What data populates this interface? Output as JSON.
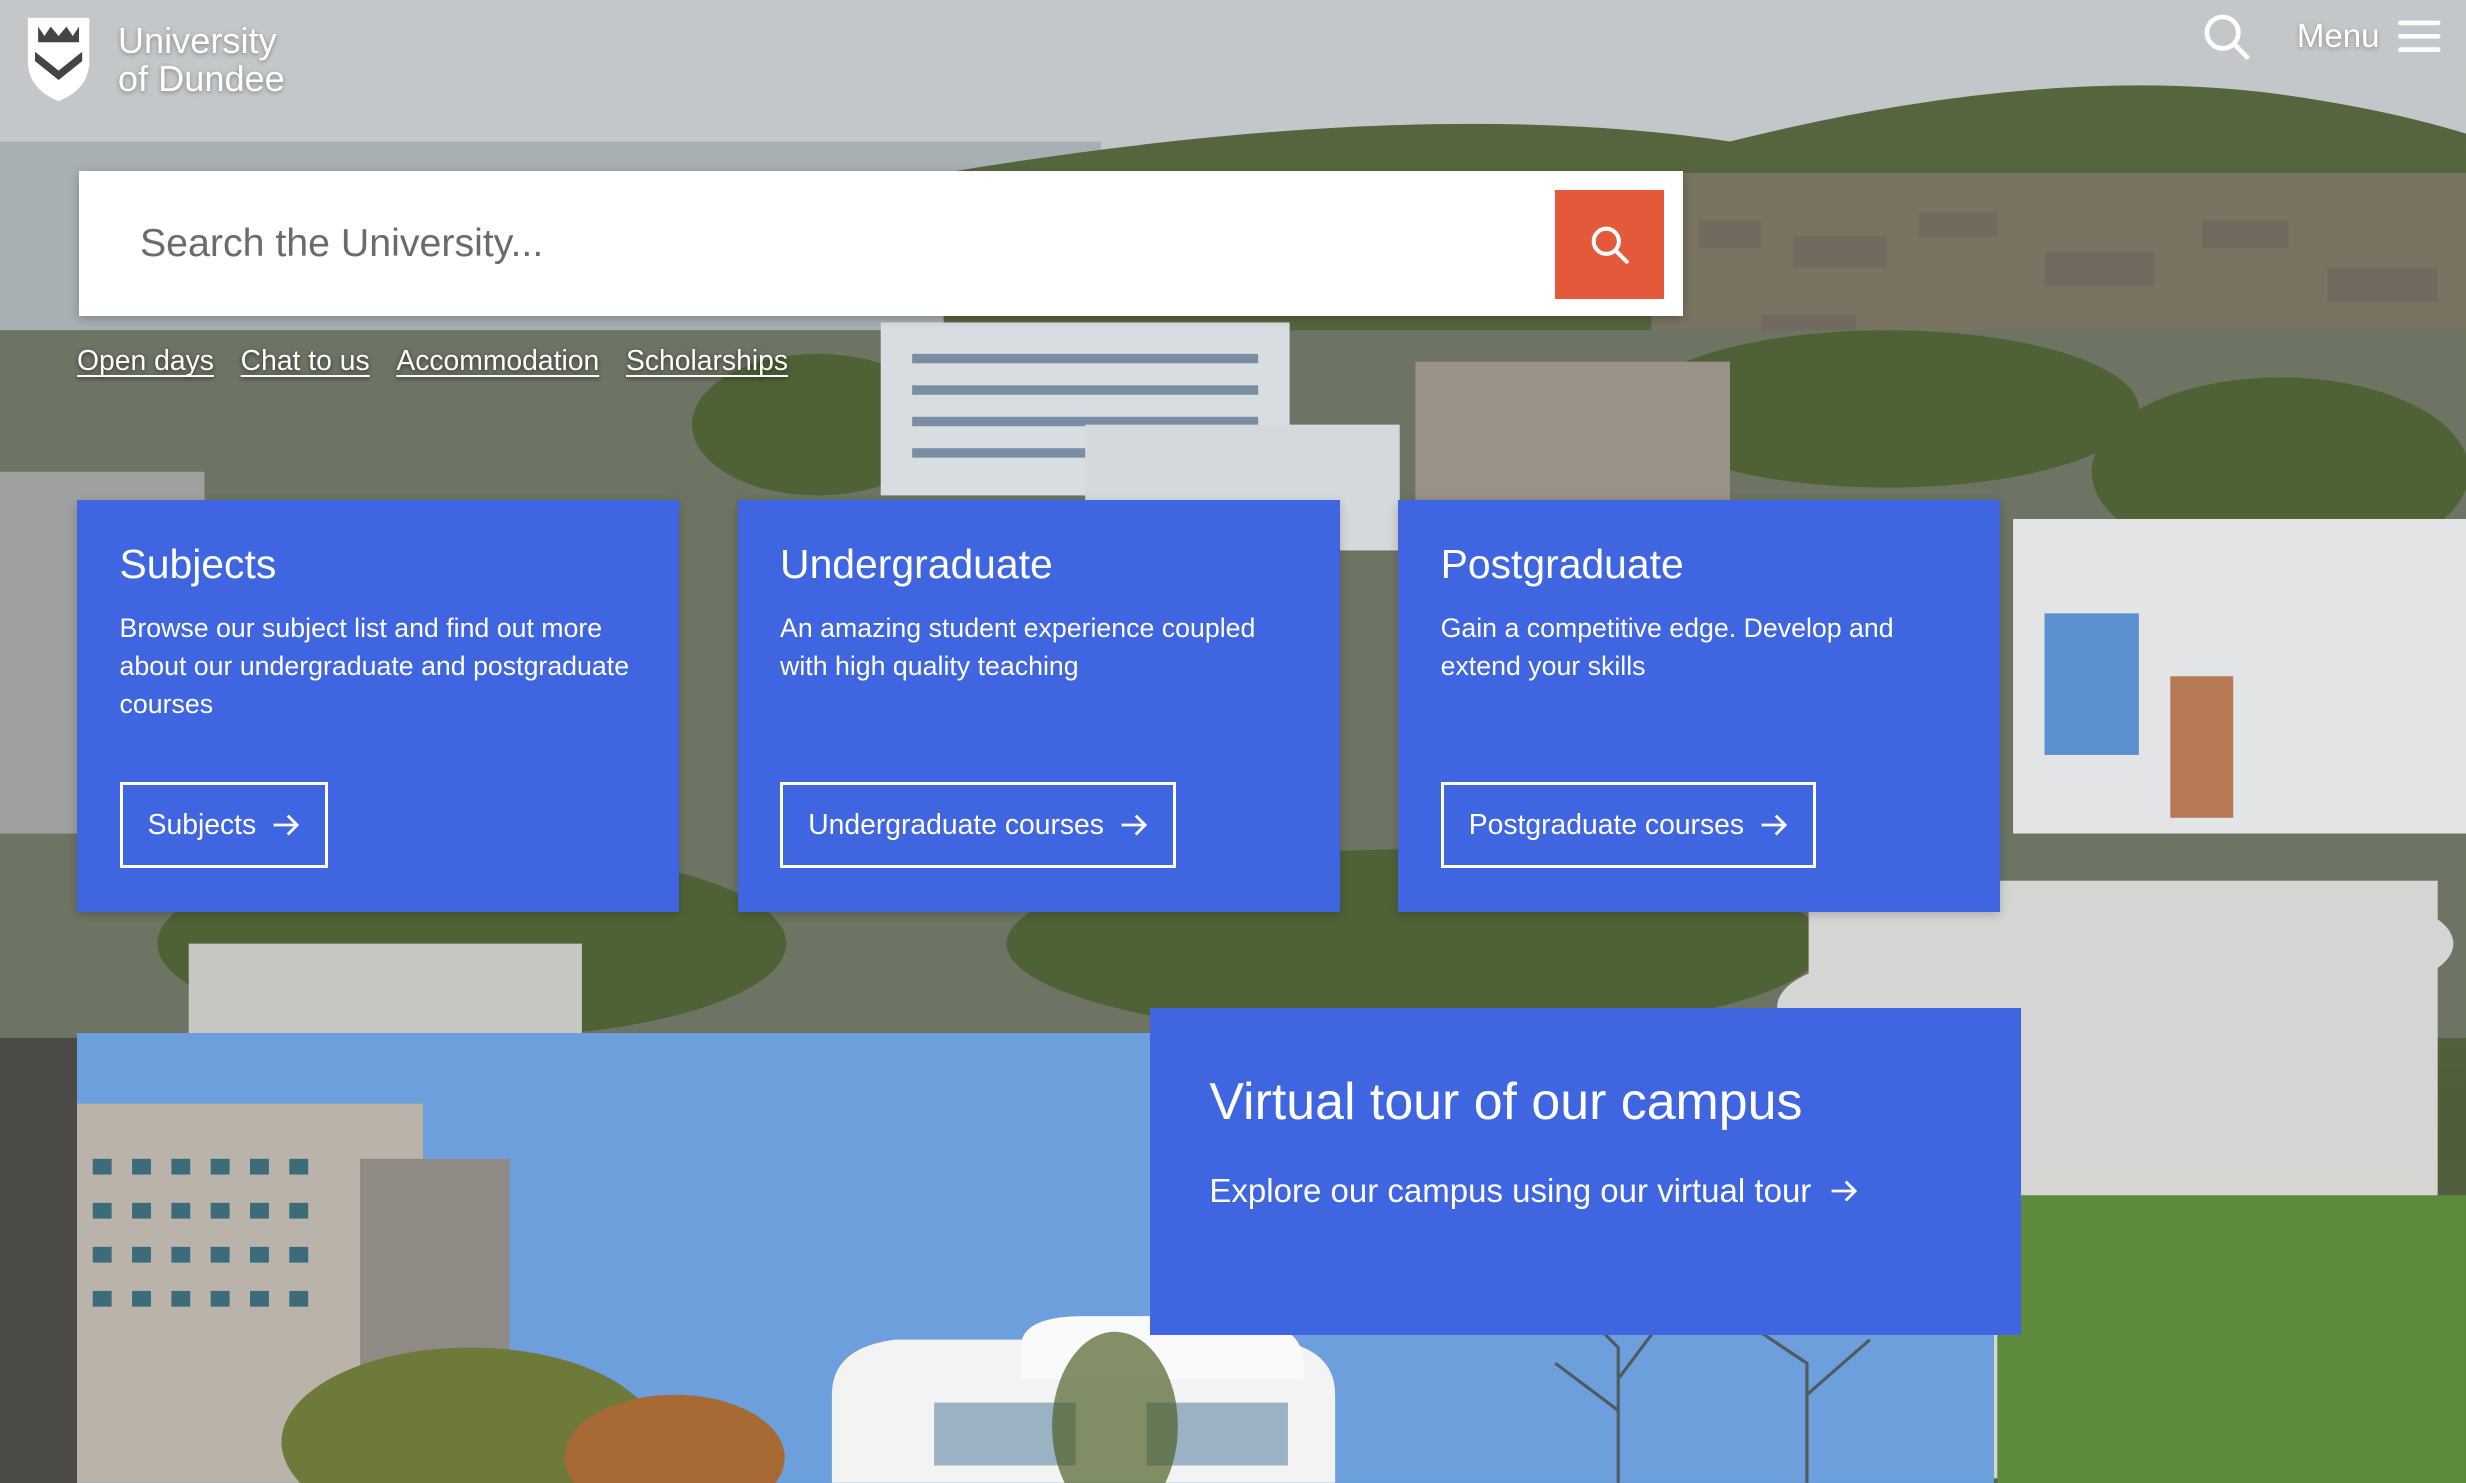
{
  "header": {
    "logo_line1": "University",
    "logo_line2": "of Dundee",
    "menu_label": "Menu",
    "icons": [
      "shield-logo",
      "search-icon",
      "hamburger-menu-icon"
    ]
  },
  "search": {
    "placeholder": "Search the University...",
    "button_color": "#e4593a"
  },
  "quick_links": [
    "Open days",
    "Chat to us",
    "Accommodation",
    "Scholarships"
  ],
  "cards": [
    {
      "title": "Subjects",
      "text": "Browse our subject list and find out more about our undergraduate and postgraduate courses",
      "button": "Subjects"
    },
    {
      "title": "Undergraduate",
      "text": "An amazing student experience coupled with high quality teaching",
      "button": "Undergraduate courses"
    },
    {
      "title": "Postgraduate",
      "text": "Gain a competitive edge. Develop and extend your skills",
      "button": "Postgraduate courses"
    }
  ],
  "virtual_tour": {
    "title": "Virtual tour of our campus",
    "link": "Explore our campus using our virtual tour"
  },
  "colors": {
    "card_blue": "#4065e0",
    "search_orange": "#e4593a"
  }
}
